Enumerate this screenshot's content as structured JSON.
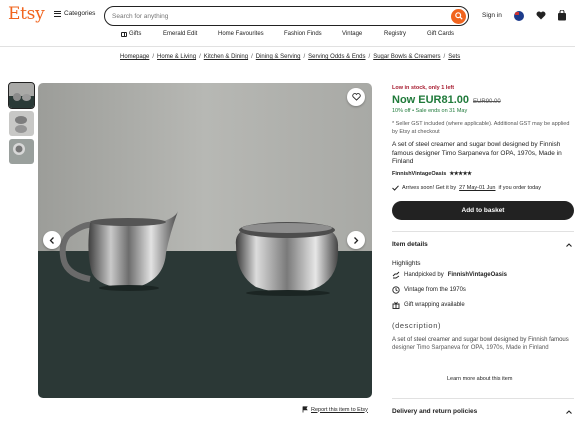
{
  "header": {
    "logo": "Etsy",
    "categories_label": "Categories",
    "search_placeholder": "Search for anything",
    "signin_label": "Sign in"
  },
  "nav": {
    "items": [
      "Gifts",
      "Emerald Edit",
      "Home Favourites",
      "Fashion Finds",
      "Vintage",
      "Registry",
      "Gift Cards"
    ]
  },
  "breadcrumb": [
    "Homepage",
    "Home & Living",
    "Kitchen & Dining",
    "Dining & Serving",
    "Serving Odds & Ends",
    "Sugar Bowls & Creamers",
    "Sets"
  ],
  "listing": {
    "stock": "Low in stock, only 1 left",
    "price_now": "Now EUR81.00",
    "price_was": "EUR90.00",
    "sale_info": "10% off  •  Sale ends on 31 May",
    "gst_note": "* Seller GST included (where applicable). Additional GST may be applied by Etsy at checkout",
    "title": "A set of steel creamer and sugar bowl designed by Finnish famous designer Timo Sarpaneva for OPA, 1970s, Made in Finland",
    "shop_name": "FinnishVintageOasis",
    "rating_stars": "★★★★★",
    "arrives_prefix": "Arrives soon! Get it by",
    "arrives_dates": "27 May-01 Jun",
    "arrives_suffix": "if you order today",
    "basket_label": "Add to basket",
    "report_label": "Report this item to Etsy"
  },
  "item_details": {
    "heading": "Item details",
    "highlights_title": "Highlights",
    "handpicked_prefix": "Handpicked by",
    "handpicked_shop": "FinnishVintageOasis",
    "vintage": "Vintage from the 1970s",
    "gift_wrap": "Gift wrapping available",
    "description_label": "(description)",
    "description_body": "A set of steel creamer and sugar bowl designed by Finnish famous designer Timo Sarpaneva for OPA, 1970s, Made in Finland",
    "learn_more": "Learn more about this item"
  },
  "delivery": {
    "heading": "Delivery and return policies"
  },
  "colors": {
    "brand": "#f1641e",
    "sale_green": "#1f7a3a",
    "stock_red": "#a61a2e"
  }
}
